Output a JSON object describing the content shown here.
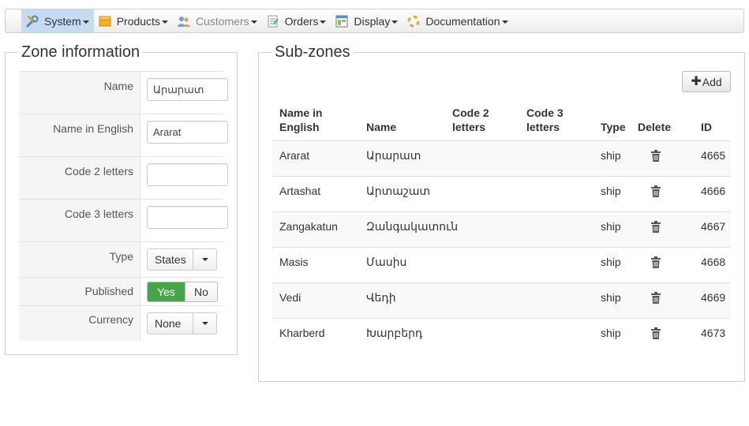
{
  "menu": {
    "items": [
      {
        "label": "System",
        "icon": "wrench-icon"
      },
      {
        "label": "Products",
        "icon": "box-icon"
      },
      {
        "label": "Customers",
        "icon": "users-icon"
      },
      {
        "label": "Orders",
        "icon": "orders-icon"
      },
      {
        "label": "Display",
        "icon": "display-icon"
      },
      {
        "label": "Documentation",
        "icon": "lifebuoy-icon"
      }
    ]
  },
  "zone": {
    "title": "Zone information",
    "name_label": "Name",
    "name_value": "Արարատ",
    "name_en_label": "Name in English",
    "name_en_value": "Ararat",
    "code2_label": "Code 2 letters",
    "code2_value": "",
    "code3_label": "Code 3 letters",
    "code3_value": "",
    "type_label": "Type",
    "type_value": "States",
    "published_label": "Published",
    "published_yes": "Yes",
    "published_no": "No",
    "currency_label": "Currency",
    "currency_value": "None"
  },
  "subzones": {
    "title": "Sub-zones",
    "add_label": "Add",
    "headers": {
      "name_en": "Name in English",
      "name": "Name",
      "code2": "Code 2 letters",
      "code3": "Code 3 letters",
      "type": "Type",
      "delete": "Delete",
      "id": "ID"
    },
    "rows": [
      {
        "name_en": "Ararat",
        "name": "Արարատ",
        "code2": "",
        "code3": "",
        "type": "ship",
        "id": "4665"
      },
      {
        "name_en": "Artashat",
        "name": "Արտաշատ",
        "code2": "",
        "code3": "",
        "type": "ship",
        "id": "4666"
      },
      {
        "name_en": "Zangakatun",
        "name": "Զանգակատուն",
        "code2": "",
        "code3": "",
        "type": "ship",
        "id": "4667"
      },
      {
        "name_en": "Masis",
        "name": "Մասիս",
        "code2": "",
        "code3": "",
        "type": "ship",
        "id": "4668"
      },
      {
        "name_en": "Vedi",
        "name": "Վեդի",
        "code2": "",
        "code3": "",
        "type": "ship",
        "id": "4669"
      },
      {
        "name_en": "Kharberd",
        "name": "Խարբերդ",
        "code2": "",
        "code3": "",
        "type": "ship",
        "id": "4673"
      }
    ]
  }
}
